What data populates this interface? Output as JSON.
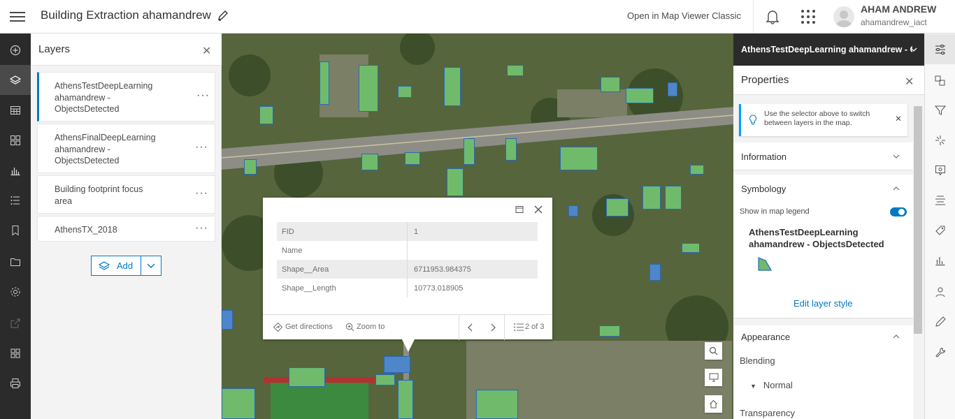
{
  "header": {
    "app_title": "Building Extraction ahamandrew",
    "classic_link": "Open in Map Viewer Classic",
    "user_name": "AHAM ANDREW",
    "user_id": "ahamandrew_iact"
  },
  "left_toolbar": {
    "icons": [
      "add-icon",
      "layers-icon",
      "table-icon",
      "basemap-icon",
      "charts-icon",
      "legend-icon",
      "bookmark-icon",
      "folder-icon",
      "settings-icon",
      "share-icon",
      "apps-icon",
      "print-icon"
    ]
  },
  "layers_panel": {
    "title": "Layers",
    "items": [
      {
        "label": "AthensTestDeepLearning ahamandrew - ObjectsDetected"
      },
      {
        "label": "AthensFinalDeepLearning ahamandrew - ObjectsDetected"
      },
      {
        "label": "Building footprint focus area"
      },
      {
        "label": "AthensTX_2018"
      }
    ],
    "add_label": "Add"
  },
  "popup": {
    "rows": [
      {
        "key": "FID",
        "value": "1"
      },
      {
        "key": "Name",
        "value": ""
      },
      {
        "key": "Shape__Area",
        "value": "6711953.984375"
      },
      {
        "key": "Shape__Length",
        "value": "10773.018905"
      }
    ],
    "get_directions": "Get directions",
    "zoom_to": "Zoom to",
    "pager": "2 of 3"
  },
  "properties": {
    "layer_selector": "AthensTestDeepLearning ahamandrew - ObjectsDetected",
    "title": "Properties",
    "notice": "Use the selector above to switch between layers in the map.",
    "information": "Information",
    "symbology": "Symbology",
    "legend_toggle_label": "Show in map legend",
    "legend_toggle_on": true,
    "symbol_layer_name": "AthensTestDeepLearning ahamandrew - ObjectsDetected",
    "edit_style": "Edit layer style",
    "appearance": "Appearance",
    "blending": "Blending",
    "blending_value": "Normal",
    "transparency": "Transparency"
  },
  "colors": {
    "accent": "#007ac2",
    "footprint_fill": "#6fbb6b",
    "footprint_outline": "#2a68b8",
    "dark_toolbar": "#2b2b2b"
  }
}
